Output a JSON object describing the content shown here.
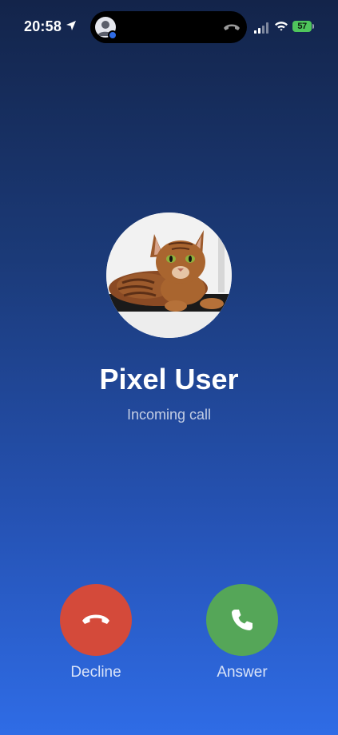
{
  "status_bar": {
    "time": "20:58",
    "battery": "57",
    "icons": [
      "location-arrow-icon",
      "cellular-icon",
      "wifi-icon",
      "battery-charging-icon"
    ]
  },
  "dynamic_island": {
    "icons": [
      "contact-avatar-icon",
      "phone-hangup-icon"
    ]
  },
  "call": {
    "contact_name": "Pixel User",
    "status": "Incoming call",
    "avatar_image": "cat-photo"
  },
  "actions": {
    "decline_label": "Decline",
    "answer_label": "Answer",
    "decline_icon": "phone-hangup-icon",
    "answer_icon": "phone-icon"
  },
  "colors": {
    "decline": "#d44a3a",
    "answer": "#55a658",
    "battery": "#4fc65c",
    "background_top": "#13244a",
    "background_bottom": "#2f6ce6"
  }
}
